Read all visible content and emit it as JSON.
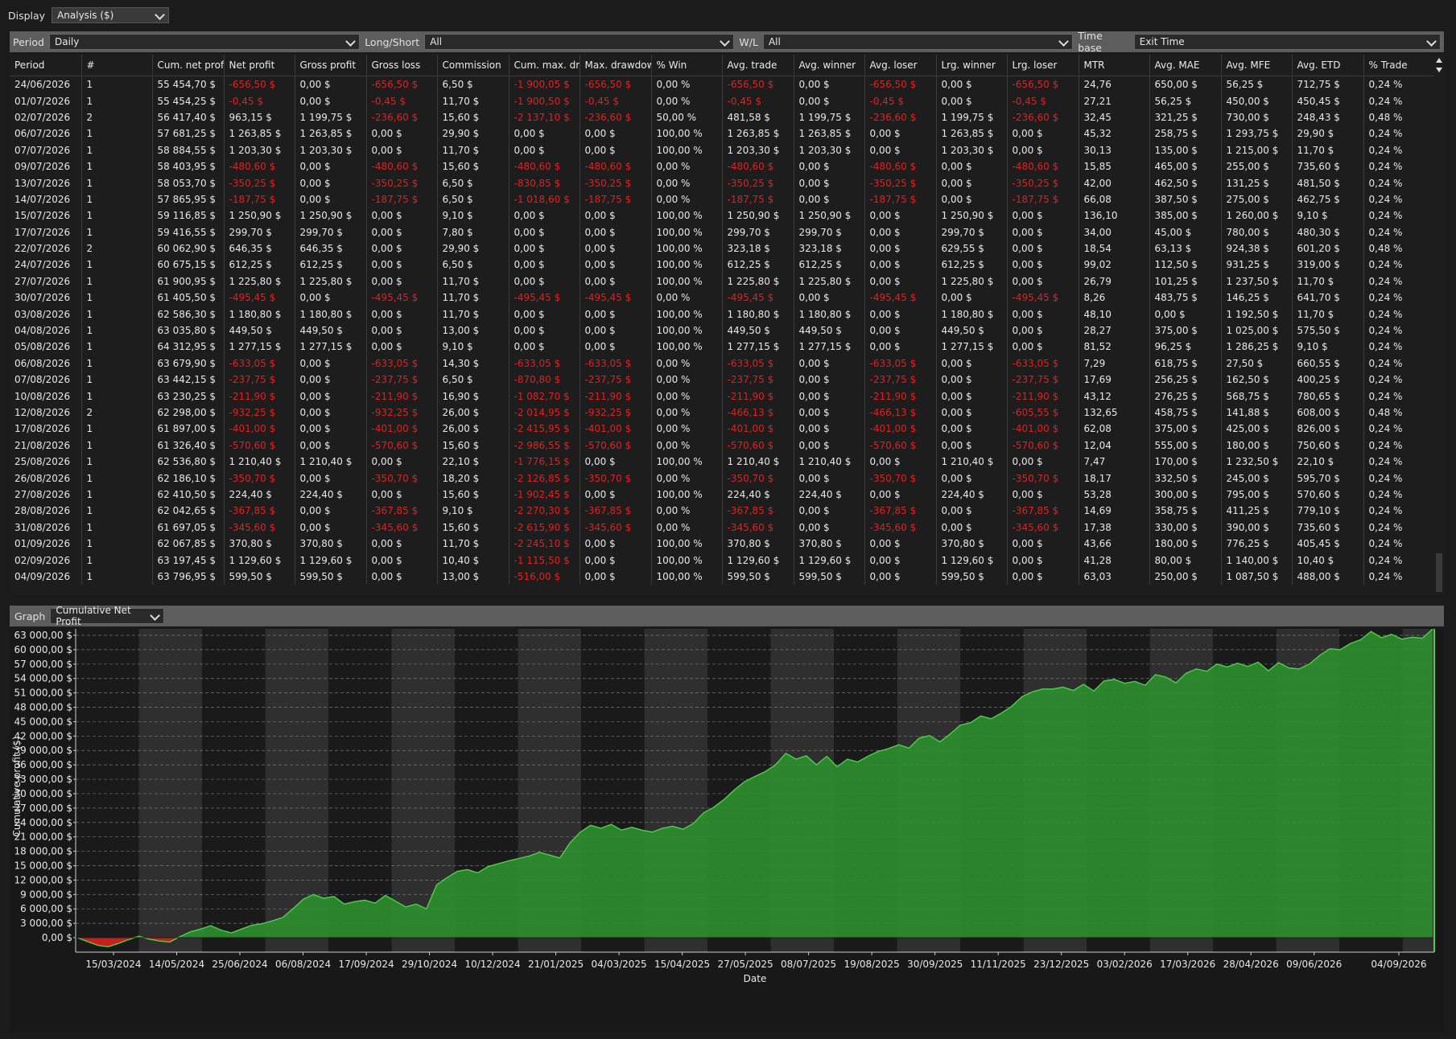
{
  "display": {
    "label": "Display",
    "value": "Analysis ($)"
  },
  "filters": {
    "period_label": "Period",
    "period_value": "Daily",
    "longshort_label": "Long/Short",
    "longshort_value": "All",
    "wl_label": "W/L",
    "wl_value": "All",
    "timebase_label": "Time base",
    "timebase_value": "Exit Time"
  },
  "table": {
    "columns": [
      "Period",
      "#",
      "Cum. net profi",
      "Net profit",
      "Gross profit",
      "Gross loss",
      "Commission",
      "Cum. max. dra",
      "Max. drawdow",
      "% Win",
      "Avg. trade",
      "Avg. winner",
      "Avg. loser",
      "Lrg. winner",
      "Lrg. loser",
      "MTR",
      "Avg. MAE",
      "Avg. MFE",
      "Avg. ETD",
      "% Trade"
    ],
    "rows": [
      [
        "24/06/2026",
        "1",
        "55 454,70 $",
        "-656,50 $",
        "0,00 $",
        "-656,50 $",
        "6,50 $",
        "-1 900,05 $",
        "-656,50 $",
        "0,00 %",
        "-656,50 $",
        "0,00 $",
        "-656,50 $",
        "0,00 $",
        "-656,50 $",
        "24,76",
        "650,00 $",
        "56,25 $",
        "712,75 $",
        "0,24 %"
      ],
      [
        "01/07/2026",
        "1",
        "55 454,25 $",
        "-0,45 $",
        "0,00 $",
        "-0,45 $",
        "11,70 $",
        "-1 900,50 $",
        "-0,45 $",
        "0,00 %",
        "-0,45 $",
        "0,00 $",
        "-0,45 $",
        "0,00 $",
        "-0,45 $",
        "27,21",
        "56,25 $",
        "450,00 $",
        "450,45 $",
        "0,24 %"
      ],
      [
        "02/07/2026",
        "2",
        "56 417,40 $",
        "963,15 $",
        "1 199,75 $",
        "-236,60 $",
        "15,60 $",
        "-2 137,10 $",
        "-236,60 $",
        "50,00 %",
        "481,58 $",
        "1 199,75 $",
        "-236,60 $",
        "1 199,75 $",
        "-236,60 $",
        "32,45",
        "321,25 $",
        "730,00 $",
        "248,43 $",
        "0,48 %"
      ],
      [
        "06/07/2026",
        "1",
        "57 681,25 $",
        "1 263,85 $",
        "1 263,85 $",
        "0,00 $",
        "29,90 $",
        "0,00 $",
        "0,00 $",
        "100,00 %",
        "1 263,85 $",
        "1 263,85 $",
        "0,00 $",
        "1 263,85 $",
        "0,00 $",
        "45,32",
        "258,75 $",
        "1 293,75 $",
        "29,90 $",
        "0,24 %"
      ],
      [
        "07/07/2026",
        "1",
        "58 884,55 $",
        "1 203,30 $",
        "1 203,30 $",
        "0,00 $",
        "11,70 $",
        "0,00 $",
        "0,00 $",
        "100,00 %",
        "1 203,30 $",
        "1 203,30 $",
        "0,00 $",
        "1 203,30 $",
        "0,00 $",
        "30,13",
        "135,00 $",
        "1 215,00 $",
        "11,70 $",
        "0,24 %"
      ],
      [
        "09/07/2026",
        "1",
        "58 403,95 $",
        "-480,60 $",
        "0,00 $",
        "-480,60 $",
        "15,60 $",
        "-480,60 $",
        "-480,60 $",
        "0,00 %",
        "-480,60 $",
        "0,00 $",
        "-480,60 $",
        "0,00 $",
        "-480,60 $",
        "15,85",
        "465,00 $",
        "255,00 $",
        "735,60 $",
        "0,24 %"
      ],
      [
        "13/07/2026",
        "1",
        "58 053,70 $",
        "-350,25 $",
        "0,00 $",
        "-350,25 $",
        "6,50 $",
        "-830,85 $",
        "-350,25 $",
        "0,00 %",
        "-350,25 $",
        "0,00 $",
        "-350,25 $",
        "0,00 $",
        "-350,25 $",
        "42,00",
        "462,50 $",
        "131,25 $",
        "481,50 $",
        "0,24 %"
      ],
      [
        "14/07/2026",
        "1",
        "57 865,95 $",
        "-187,75 $",
        "0,00 $",
        "-187,75 $",
        "6,50 $",
        "-1 018,60 $",
        "-187,75 $",
        "0,00 %",
        "-187,75 $",
        "0,00 $",
        "-187,75 $",
        "0,00 $",
        "-187,75 $",
        "66,08",
        "387,50 $",
        "275,00 $",
        "462,75 $",
        "0,24 %"
      ],
      [
        "15/07/2026",
        "1",
        "59 116,85 $",
        "1 250,90 $",
        "1 250,90 $",
        "0,00 $",
        "9,10 $",
        "0,00 $",
        "0,00 $",
        "100,00 %",
        "1 250,90 $",
        "1 250,90 $",
        "0,00 $",
        "1 250,90 $",
        "0,00 $",
        "136,10",
        "385,00 $",
        "1 260,00 $",
        "9,10 $",
        "0,24 %"
      ],
      [
        "17/07/2026",
        "1",
        "59 416,55 $",
        "299,70 $",
        "299,70 $",
        "0,00 $",
        "7,80 $",
        "0,00 $",
        "0,00 $",
        "100,00 %",
        "299,70 $",
        "299,70 $",
        "0,00 $",
        "299,70 $",
        "0,00 $",
        "34,00",
        "45,00 $",
        "780,00 $",
        "480,30 $",
        "0,24 %"
      ],
      [
        "22/07/2026",
        "2",
        "60 062,90 $",
        "646,35 $",
        "646,35 $",
        "0,00 $",
        "29,90 $",
        "0,00 $",
        "0,00 $",
        "100,00 %",
        "323,18 $",
        "323,18 $",
        "0,00 $",
        "629,55 $",
        "0,00 $",
        "18,54",
        "63,13 $",
        "924,38 $",
        "601,20 $",
        "0,48 %"
      ],
      [
        "24/07/2026",
        "1",
        "60 675,15 $",
        "612,25 $",
        "612,25 $",
        "0,00 $",
        "6,50 $",
        "0,00 $",
        "0,00 $",
        "100,00 %",
        "612,25 $",
        "612,25 $",
        "0,00 $",
        "612,25 $",
        "0,00 $",
        "99,02",
        "112,50 $",
        "931,25 $",
        "319,00 $",
        "0,24 %"
      ],
      [
        "27/07/2026",
        "1",
        "61 900,95 $",
        "1 225,80 $",
        "1 225,80 $",
        "0,00 $",
        "11,70 $",
        "0,00 $",
        "0,00 $",
        "100,00 %",
        "1 225,80 $",
        "1 225,80 $",
        "0,00 $",
        "1 225,80 $",
        "0,00 $",
        "26,79",
        "101,25 $",
        "1 237,50 $",
        "11,70 $",
        "0,24 %"
      ],
      [
        "30/07/2026",
        "1",
        "61 405,50 $",
        "-495,45 $",
        "0,00 $",
        "-495,45 $",
        "11,70 $",
        "-495,45 $",
        "-495,45 $",
        "0,00 %",
        "-495,45 $",
        "0,00 $",
        "-495,45 $",
        "0,00 $",
        "-495,45 $",
        "8,26",
        "483,75 $",
        "146,25 $",
        "641,70 $",
        "0,24 %"
      ],
      [
        "03/08/2026",
        "1",
        "62 586,30 $",
        "1 180,80 $",
        "1 180,80 $",
        "0,00 $",
        "11,70 $",
        "0,00 $",
        "0,00 $",
        "100,00 %",
        "1 180,80 $",
        "1 180,80 $",
        "0,00 $",
        "1 180,80 $",
        "0,00 $",
        "48,10",
        "0,00 $",
        "1 192,50 $",
        "11,70 $",
        "0,24 %"
      ],
      [
        "04/08/2026",
        "1",
        "63 035,80 $",
        "449,50 $",
        "449,50 $",
        "0,00 $",
        "13,00 $",
        "0,00 $",
        "0,00 $",
        "100,00 %",
        "449,50 $",
        "449,50 $",
        "0,00 $",
        "449,50 $",
        "0,00 $",
        "28,27",
        "375,00 $",
        "1 025,00 $",
        "575,50 $",
        "0,24 %"
      ],
      [
        "05/08/2026",
        "1",
        "64 312,95 $",
        "1 277,15 $",
        "1 277,15 $",
        "0,00 $",
        "9,10 $",
        "0,00 $",
        "0,00 $",
        "100,00 %",
        "1 277,15 $",
        "1 277,15 $",
        "0,00 $",
        "1 277,15 $",
        "0,00 $",
        "81,52",
        "96,25 $",
        "1 286,25 $",
        "9,10 $",
        "0,24 %"
      ],
      [
        "06/08/2026",
        "1",
        "63 679,90 $",
        "-633,05 $",
        "0,00 $",
        "-633,05 $",
        "14,30 $",
        "-633,05 $",
        "-633,05 $",
        "0,00 %",
        "-633,05 $",
        "0,00 $",
        "-633,05 $",
        "0,00 $",
        "-633,05 $",
        "7,29",
        "618,75 $",
        "27,50 $",
        "660,55 $",
        "0,24 %"
      ],
      [
        "07/08/2026",
        "1",
        "63 442,15 $",
        "-237,75 $",
        "0,00 $",
        "-237,75 $",
        "6,50 $",
        "-870,80 $",
        "-237,75 $",
        "0,00 %",
        "-237,75 $",
        "0,00 $",
        "-237,75 $",
        "0,00 $",
        "-237,75 $",
        "17,69",
        "256,25 $",
        "162,50 $",
        "400,25 $",
        "0,24 %"
      ],
      [
        "10/08/2026",
        "1",
        "63 230,25 $",
        "-211,90 $",
        "0,00 $",
        "-211,90 $",
        "16,90 $",
        "-1 082,70 $",
        "-211,90 $",
        "0,00 %",
        "-211,90 $",
        "0,00 $",
        "-211,90 $",
        "0,00 $",
        "-211,90 $",
        "43,12",
        "276,25 $",
        "568,75 $",
        "780,65 $",
        "0,24 %"
      ],
      [
        "12/08/2026",
        "2",
        "62 298,00 $",
        "-932,25 $",
        "0,00 $",
        "-932,25 $",
        "26,00 $",
        "-2 014,95 $",
        "-932,25 $",
        "0,00 %",
        "-466,13 $",
        "0,00 $",
        "-466,13 $",
        "0,00 $",
        "-605,55 $",
        "132,65",
        "458,75 $",
        "141,88 $",
        "608,00 $",
        "0,48 %"
      ],
      [
        "17/08/2026",
        "1",
        "61 897,00 $",
        "-401,00 $",
        "0,00 $",
        "-401,00 $",
        "26,00 $",
        "-2 415,95 $",
        "-401,00 $",
        "0,00 %",
        "-401,00 $",
        "0,00 $",
        "-401,00 $",
        "0,00 $",
        "-401,00 $",
        "62,08",
        "375,00 $",
        "425,00 $",
        "826,00 $",
        "0,24 %"
      ],
      [
        "21/08/2026",
        "1",
        "61 326,40 $",
        "-570,60 $",
        "0,00 $",
        "-570,60 $",
        "15,60 $",
        "-2 986,55 $",
        "-570,60 $",
        "0,00 %",
        "-570,60 $",
        "0,00 $",
        "-570,60 $",
        "0,00 $",
        "-570,60 $",
        "12,04",
        "555,00 $",
        "180,00 $",
        "750,60 $",
        "0,24 %"
      ],
      [
        "25/08/2026",
        "1",
        "62 536,80 $",
        "1 210,40 $",
        "1 210,40 $",
        "0,00 $",
        "22,10 $",
        "-1 776,15 $",
        "0,00 $",
        "100,00 %",
        "1 210,40 $",
        "1 210,40 $",
        "0,00 $",
        "1 210,40 $",
        "0,00 $",
        "7,47",
        "170,00 $",
        "1 232,50 $",
        "22,10 $",
        "0,24 %"
      ],
      [
        "26/08/2026",
        "1",
        "62 186,10 $",
        "-350,70 $",
        "0,00 $",
        "-350,70 $",
        "18,20 $",
        "-2 126,85 $",
        "-350,70 $",
        "0,00 %",
        "-350,70 $",
        "0,00 $",
        "-350,70 $",
        "0,00 $",
        "-350,70 $",
        "18,17",
        "332,50 $",
        "245,00 $",
        "595,70 $",
        "0,24 %"
      ],
      [
        "27/08/2026",
        "1",
        "62 410,50 $",
        "224,40 $",
        "224,40 $",
        "0,00 $",
        "15,60 $",
        "-1 902,45 $",
        "0,00 $",
        "100,00 %",
        "224,40 $",
        "224,40 $",
        "0,00 $",
        "224,40 $",
        "0,00 $",
        "53,28",
        "300,00 $",
        "795,00 $",
        "570,60 $",
        "0,24 %"
      ],
      [
        "28/08/2026",
        "1",
        "62 042,65 $",
        "-367,85 $",
        "0,00 $",
        "-367,85 $",
        "9,10 $",
        "-2 270,30 $",
        "-367,85 $",
        "0,00 %",
        "-367,85 $",
        "0,00 $",
        "-367,85 $",
        "0,00 $",
        "-367,85 $",
        "14,69",
        "358,75 $",
        "411,25 $",
        "779,10 $",
        "0,24 %"
      ],
      [
        "31/08/2026",
        "1",
        "61 697,05 $",
        "-345,60 $",
        "0,00 $",
        "-345,60 $",
        "15,60 $",
        "-2 615,90 $",
        "-345,60 $",
        "0,00 %",
        "-345,60 $",
        "0,00 $",
        "-345,60 $",
        "0,00 $",
        "-345,60 $",
        "17,38",
        "330,00 $",
        "390,00 $",
        "735,60 $",
        "0,24 %"
      ],
      [
        "01/09/2026",
        "1",
        "62 067,85 $",
        "370,80 $",
        "370,80 $",
        "0,00 $",
        "11,70 $",
        "-2 245,10 $",
        "0,00 $",
        "100,00 %",
        "370,80 $",
        "370,80 $",
        "0,00 $",
        "370,80 $",
        "0,00 $",
        "43,66",
        "180,00 $",
        "776,25 $",
        "405,45 $",
        "0,24 %"
      ],
      [
        "02/09/2026",
        "1",
        "63 197,45 $",
        "1 129,60 $",
        "1 129,60 $",
        "0,00 $",
        "10,40 $",
        "-1 115,50 $",
        "0,00 $",
        "100,00 %",
        "1 129,60 $",
        "1 129,60 $",
        "0,00 $",
        "1 129,60 $",
        "0,00 $",
        "41,28",
        "80,00 $",
        "1 140,00 $",
        "10,40 $",
        "0,24 %"
      ],
      [
        "04/09/2026",
        "1",
        "63 796,95 $",
        "599,50 $",
        "599,50 $",
        "0,00 $",
        "13,00 $",
        "-516,00 $",
        "0,00 $",
        "100,00 %",
        "599,50 $",
        "599,50 $",
        "0,00 $",
        "599,50 $",
        "0,00 $",
        "63,03",
        "250,00 $",
        "1 087,50 $",
        "488,00 $",
        "0,24 %"
      ]
    ]
  },
  "graph": {
    "label": "Graph",
    "value": "Cumulative Net Profit"
  },
  "chart_data": {
    "type": "area",
    "xlabel": "Date",
    "ylabel": "Cumulative profit ($)",
    "ylim": [
      -2000,
      64000
    ],
    "yticks": [
      "63 000,00 $",
      "60 000,00 $",
      "57 000,00 $",
      "54 000,00 $",
      "51 000,00 $",
      "48 000,00 $",
      "45 000,00 $",
      "42 000,00 $",
      "39 000,00 $",
      "36 000,00 $",
      "33 000,00 $",
      "30 000,00 $",
      "27 000,00 $",
      "24 000,00 $",
      "21 000,00 $",
      "18 000,00 $",
      "15 000,00 $",
      "12 000,00 $",
      "9 000,00 $",
      "6 000,00 $",
      "3 000,00 $",
      "0,00 $"
    ],
    "ytick_values": [
      63000,
      60000,
      57000,
      54000,
      51000,
      48000,
      45000,
      42000,
      39000,
      36000,
      33000,
      30000,
      27000,
      24000,
      21000,
      18000,
      15000,
      12000,
      9000,
      6000,
      3000,
      0
    ],
    "xticks": [
      "15/03/2024",
      "14/05/2024",
      "25/06/2024",
      "06/08/2024",
      "17/09/2024",
      "29/10/2024",
      "10/12/2024",
      "21/01/2025",
      "04/03/2025",
      "15/04/2025",
      "27/05/2025",
      "08/07/2025",
      "19/08/2025",
      "30/09/2025",
      "11/11/2025",
      "23/12/2025",
      "03/02/2026",
      "17/03/2026",
      "28/04/2026",
      "09/06/2026",
      "04/09/2026"
    ],
    "grid": true,
    "positive_color": "#2e8f2e",
    "negative_color": "#c81e1e",
    "series": [
      {
        "values": [
          0,
          -800,
          -1600,
          -1900,
          -1200,
          -400,
          300,
          -300,
          -700,
          -900,
          200,
          1200,
          1800,
          2500,
          1600,
          1000,
          1800,
          2600,
          2900,
          3500,
          4200,
          6000,
          8000,
          9000,
          8200,
          8600,
          7000,
          7500,
          7800,
          7200,
          8800,
          7600,
          6400,
          7000,
          6000,
          11000,
          12500,
          13800,
          14200,
          13500,
          14800,
          15400,
          16000,
          16500,
          17000,
          17800,
          17200,
          16600,
          19800,
          22000,
          23400,
          22800,
          23600,
          22400,
          23000,
          22400,
          22000,
          22800,
          23200,
          22600,
          23800,
          26000,
          27200,
          28800,
          30800,
          32500,
          33600,
          34600,
          36000,
          38400,
          37200,
          37900,
          36000,
          37800,
          35600,
          37200,
          36600,
          37800,
          38800,
          39400,
          40200,
          39500,
          41600,
          42100,
          40800,
          42400,
          44300,
          44800,
          46200,
          45600,
          46800,
          48200,
          50200,
          51200,
          51800,
          51800,
          52200,
          51500,
          52800,
          51400,
          53500,
          53800,
          53000,
          53400,
          52600,
          54800,
          54300,
          53100,
          55100,
          56000,
          55500,
          57000,
          56400,
          57200,
          56500,
          57400,
          55600,
          57300,
          56200,
          56000,
          57000,
          58800,
          60200,
          60000,
          61300,
          62100,
          63800,
          62500,
          63200,
          62200,
          62600,
          62400,
          64300
        ]
      }
    ]
  }
}
